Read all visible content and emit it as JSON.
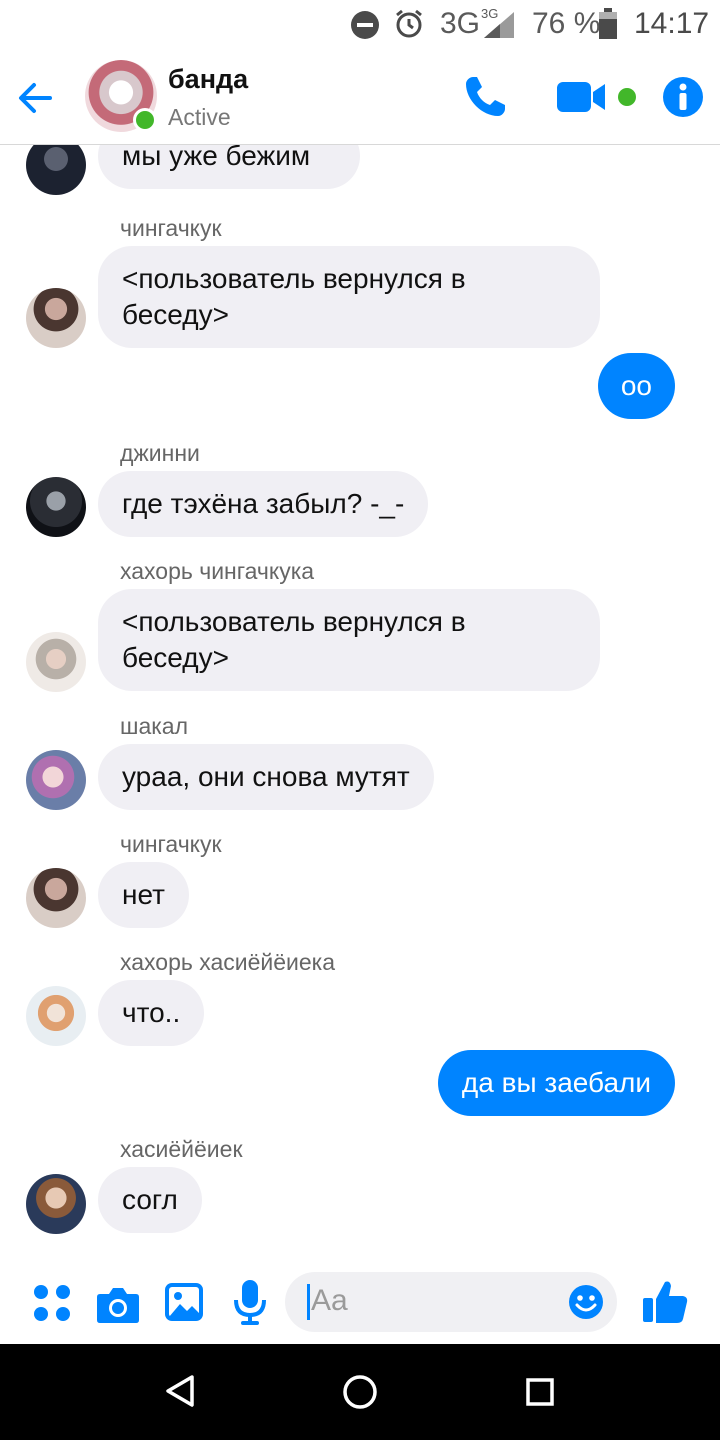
{
  "status_bar": {
    "network": "3G",
    "network_sup": "3G",
    "battery": "76 %",
    "time": "14:17",
    "icons": [
      "do-not-disturb-icon",
      "alarm-icon",
      "signal-icon",
      "battery-icon"
    ]
  },
  "header": {
    "title": "банда",
    "status": "Active",
    "icons": [
      "back-arrow-icon",
      "phone-icon",
      "video-icon",
      "info-icon"
    ],
    "accent_color": "#0084ff",
    "online_color": "#42b72a"
  },
  "messages": [
    {
      "type": "in",
      "text": "мы уже бежим"
    },
    {
      "type": "in",
      "sender": "чингачкук",
      "text": "<пользователь вернулся в беседу>"
    },
    {
      "type": "out",
      "text": "оо"
    },
    {
      "type": "in",
      "sender": "джинни",
      "text": "где тэхёна забыл? -_-"
    },
    {
      "type": "in",
      "sender": "хахорь чингачкука",
      "text": "<пользователь вернулся в беседу>"
    },
    {
      "type": "in",
      "sender": "шакал",
      "text": "ураа, они снова мутят"
    },
    {
      "type": "in",
      "sender": "чингачкук",
      "text": "нет"
    },
    {
      "type": "in",
      "sender": "хахорь хасиёйёиека",
      "text": "что.."
    },
    {
      "type": "out",
      "text": "да вы заебали"
    },
    {
      "type": "in",
      "sender": "хасиёйёиек",
      "text": "согл"
    }
  ],
  "composer": {
    "placeholder": "Aa",
    "icons": [
      "more-apps-icon",
      "camera-icon",
      "gallery-icon",
      "microphone-icon",
      "emoji-icon",
      "thumbs-up-icon"
    ]
  },
  "nav": {
    "icons": [
      "back-triangle-icon",
      "home-circle-icon",
      "recents-square-icon"
    ]
  },
  "colors": {
    "incoming_bubble": "#f0eff4",
    "outgoing_bubble": "#0084ff"
  }
}
